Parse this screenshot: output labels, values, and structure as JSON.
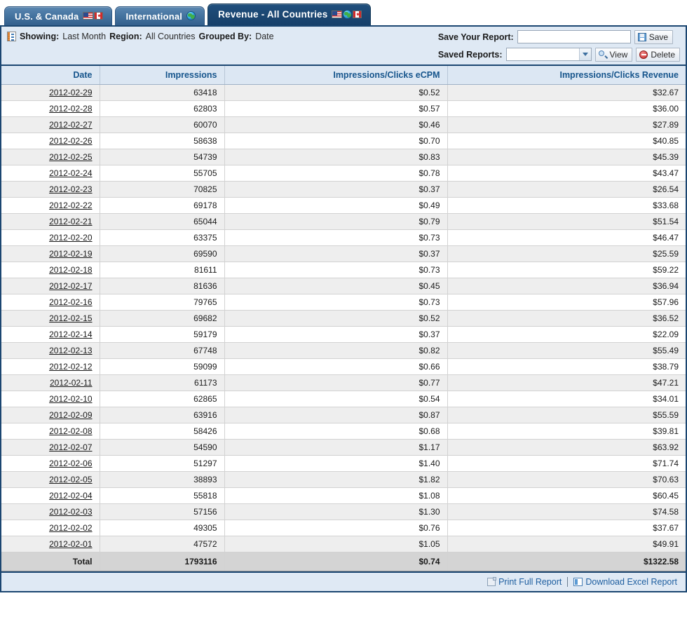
{
  "tabs": [
    {
      "label": "U.S. & Canada",
      "active": false,
      "icons": [
        "flag-us-icon",
        "flag-canada-icon"
      ]
    },
    {
      "label": "International",
      "active": false,
      "icons": [
        "globe-icon"
      ]
    },
    {
      "label": "Revenue - All Countries",
      "active": true,
      "icons": [
        "flag-us-icon",
        "globe-icon",
        "flag-canada-icon"
      ]
    }
  ],
  "toolbar": {
    "report_icon": "report-icon",
    "showing_label": "Showing:",
    "showing_value": "Last Month",
    "region_label": "Region:",
    "region_value": "All Countries",
    "grouped_label": "Grouped By:",
    "grouped_value": "Date",
    "save_report_label": "Save Your Report:",
    "save_report_value": "",
    "save_report_placeholder": "",
    "save_button": "Save",
    "save_icon": "floppy-disk-icon",
    "saved_reports_label": "Saved Reports:",
    "saved_reports_value": "",
    "view_button": "View",
    "view_icon": "magnifier-icon",
    "delete_button": "Delete",
    "delete_icon": "no-entry-icon"
  },
  "table": {
    "columns": [
      "Date",
      "Impressions",
      "Impressions/Clicks eCPM",
      "Impressions/Clicks Revenue"
    ],
    "rows": [
      [
        "2012-02-29",
        "63418",
        "$0.52",
        "$32.67"
      ],
      [
        "2012-02-28",
        "62803",
        "$0.57",
        "$36.00"
      ],
      [
        "2012-02-27",
        "60070",
        "$0.46",
        "$27.89"
      ],
      [
        "2012-02-26",
        "58638",
        "$0.70",
        "$40.85"
      ],
      [
        "2012-02-25",
        "54739",
        "$0.83",
        "$45.39"
      ],
      [
        "2012-02-24",
        "55705",
        "$0.78",
        "$43.47"
      ],
      [
        "2012-02-23",
        "70825",
        "$0.37",
        "$26.54"
      ],
      [
        "2012-02-22",
        "69178",
        "$0.49",
        "$33.68"
      ],
      [
        "2012-02-21",
        "65044",
        "$0.79",
        "$51.54"
      ],
      [
        "2012-02-20",
        "63375",
        "$0.73",
        "$46.47"
      ],
      [
        "2012-02-19",
        "69590",
        "$0.37",
        "$25.59"
      ],
      [
        "2012-02-18",
        "81611",
        "$0.73",
        "$59.22"
      ],
      [
        "2012-02-17",
        "81636",
        "$0.45",
        "$36.94"
      ],
      [
        "2012-02-16",
        "79765",
        "$0.73",
        "$57.96"
      ],
      [
        "2012-02-15",
        "69682",
        "$0.52",
        "$36.52"
      ],
      [
        "2012-02-14",
        "59179",
        "$0.37",
        "$22.09"
      ],
      [
        "2012-02-13",
        "67748",
        "$0.82",
        "$55.49"
      ],
      [
        "2012-02-12",
        "59099",
        "$0.66",
        "$38.79"
      ],
      [
        "2012-02-11",
        "61173",
        "$0.77",
        "$47.21"
      ],
      [
        "2012-02-10",
        "62865",
        "$0.54",
        "$34.01"
      ],
      [
        "2012-02-09",
        "63916",
        "$0.87",
        "$55.59"
      ],
      [
        "2012-02-08",
        "58426",
        "$0.68",
        "$39.81"
      ],
      [
        "2012-02-07",
        "54590",
        "$1.17",
        "$63.92"
      ],
      [
        "2012-02-06",
        "51297",
        "$1.40",
        "$71.74"
      ],
      [
        "2012-02-05",
        "38893",
        "$1.82",
        "$70.63"
      ],
      [
        "2012-02-04",
        "55818",
        "$1.08",
        "$60.45"
      ],
      [
        "2012-02-03",
        "57156",
        "$1.30",
        "$74.58"
      ],
      [
        "2012-02-02",
        "49305",
        "$0.76",
        "$37.67"
      ],
      [
        "2012-02-01",
        "47572",
        "$1.05",
        "$49.91"
      ]
    ],
    "total_row": [
      "Total",
      "1793116",
      "$0.74",
      "$1322.58"
    ]
  },
  "footer": {
    "print_label": "Print Full Report",
    "print_icon": "printer-icon",
    "download_label": "Download Excel Report",
    "download_icon": "excel-file-icon"
  },
  "colors": {
    "tab_active": "#1b4671",
    "tab_inactive": "#44739f",
    "toolbar_bg": "#dfe9f4",
    "header_bg": "#dce7f3",
    "header_text": "#16558c",
    "row_odd": "#eeeeee",
    "row_even": "#ffffff",
    "total_bg": "#d4d4d4",
    "border": "#1b4671"
  }
}
